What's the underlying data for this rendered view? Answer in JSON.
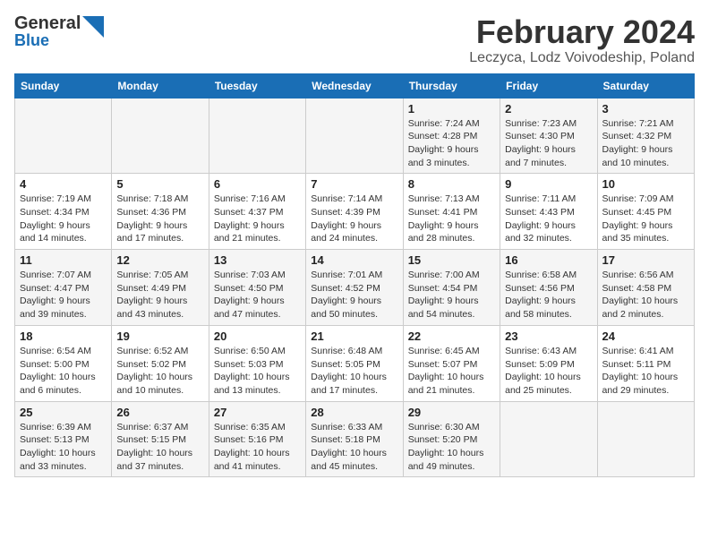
{
  "header": {
    "logo_line1": "General",
    "logo_line2": "Blue",
    "month_title": "February 2024",
    "location": "Leczyca, Lodz Voivodeship, Poland"
  },
  "weekdays": [
    "Sunday",
    "Monday",
    "Tuesday",
    "Wednesday",
    "Thursday",
    "Friday",
    "Saturday"
  ],
  "weeks": [
    [
      {
        "day": "",
        "info": ""
      },
      {
        "day": "",
        "info": ""
      },
      {
        "day": "",
        "info": ""
      },
      {
        "day": "",
        "info": ""
      },
      {
        "day": "1",
        "info": "Sunrise: 7:24 AM\nSunset: 4:28 PM\nDaylight: 9 hours\nand 3 minutes."
      },
      {
        "day": "2",
        "info": "Sunrise: 7:23 AM\nSunset: 4:30 PM\nDaylight: 9 hours\nand 7 minutes."
      },
      {
        "day": "3",
        "info": "Sunrise: 7:21 AM\nSunset: 4:32 PM\nDaylight: 9 hours\nand 10 minutes."
      }
    ],
    [
      {
        "day": "4",
        "info": "Sunrise: 7:19 AM\nSunset: 4:34 PM\nDaylight: 9 hours\nand 14 minutes."
      },
      {
        "day": "5",
        "info": "Sunrise: 7:18 AM\nSunset: 4:36 PM\nDaylight: 9 hours\nand 17 minutes."
      },
      {
        "day": "6",
        "info": "Sunrise: 7:16 AM\nSunset: 4:37 PM\nDaylight: 9 hours\nand 21 minutes."
      },
      {
        "day": "7",
        "info": "Sunrise: 7:14 AM\nSunset: 4:39 PM\nDaylight: 9 hours\nand 24 minutes."
      },
      {
        "day": "8",
        "info": "Sunrise: 7:13 AM\nSunset: 4:41 PM\nDaylight: 9 hours\nand 28 minutes."
      },
      {
        "day": "9",
        "info": "Sunrise: 7:11 AM\nSunset: 4:43 PM\nDaylight: 9 hours\nand 32 minutes."
      },
      {
        "day": "10",
        "info": "Sunrise: 7:09 AM\nSunset: 4:45 PM\nDaylight: 9 hours\nand 35 minutes."
      }
    ],
    [
      {
        "day": "11",
        "info": "Sunrise: 7:07 AM\nSunset: 4:47 PM\nDaylight: 9 hours\nand 39 minutes."
      },
      {
        "day": "12",
        "info": "Sunrise: 7:05 AM\nSunset: 4:49 PM\nDaylight: 9 hours\nand 43 minutes."
      },
      {
        "day": "13",
        "info": "Sunrise: 7:03 AM\nSunset: 4:50 PM\nDaylight: 9 hours\nand 47 minutes."
      },
      {
        "day": "14",
        "info": "Sunrise: 7:01 AM\nSunset: 4:52 PM\nDaylight: 9 hours\nand 50 minutes."
      },
      {
        "day": "15",
        "info": "Sunrise: 7:00 AM\nSunset: 4:54 PM\nDaylight: 9 hours\nand 54 minutes."
      },
      {
        "day": "16",
        "info": "Sunrise: 6:58 AM\nSunset: 4:56 PM\nDaylight: 9 hours\nand 58 minutes."
      },
      {
        "day": "17",
        "info": "Sunrise: 6:56 AM\nSunset: 4:58 PM\nDaylight: 10 hours\nand 2 minutes."
      }
    ],
    [
      {
        "day": "18",
        "info": "Sunrise: 6:54 AM\nSunset: 5:00 PM\nDaylight: 10 hours\nand 6 minutes."
      },
      {
        "day": "19",
        "info": "Sunrise: 6:52 AM\nSunset: 5:02 PM\nDaylight: 10 hours\nand 10 minutes."
      },
      {
        "day": "20",
        "info": "Sunrise: 6:50 AM\nSunset: 5:03 PM\nDaylight: 10 hours\nand 13 minutes."
      },
      {
        "day": "21",
        "info": "Sunrise: 6:48 AM\nSunset: 5:05 PM\nDaylight: 10 hours\nand 17 minutes."
      },
      {
        "day": "22",
        "info": "Sunrise: 6:45 AM\nSunset: 5:07 PM\nDaylight: 10 hours\nand 21 minutes."
      },
      {
        "day": "23",
        "info": "Sunrise: 6:43 AM\nSunset: 5:09 PM\nDaylight: 10 hours\nand 25 minutes."
      },
      {
        "day": "24",
        "info": "Sunrise: 6:41 AM\nSunset: 5:11 PM\nDaylight: 10 hours\nand 29 minutes."
      }
    ],
    [
      {
        "day": "25",
        "info": "Sunrise: 6:39 AM\nSunset: 5:13 PM\nDaylight: 10 hours\nand 33 minutes."
      },
      {
        "day": "26",
        "info": "Sunrise: 6:37 AM\nSunset: 5:15 PM\nDaylight: 10 hours\nand 37 minutes."
      },
      {
        "day": "27",
        "info": "Sunrise: 6:35 AM\nSunset: 5:16 PM\nDaylight: 10 hours\nand 41 minutes."
      },
      {
        "day": "28",
        "info": "Sunrise: 6:33 AM\nSunset: 5:18 PM\nDaylight: 10 hours\nand 45 minutes."
      },
      {
        "day": "29",
        "info": "Sunrise: 6:30 AM\nSunset: 5:20 PM\nDaylight: 10 hours\nand 49 minutes."
      },
      {
        "day": "",
        "info": ""
      },
      {
        "day": "",
        "info": ""
      }
    ]
  ]
}
